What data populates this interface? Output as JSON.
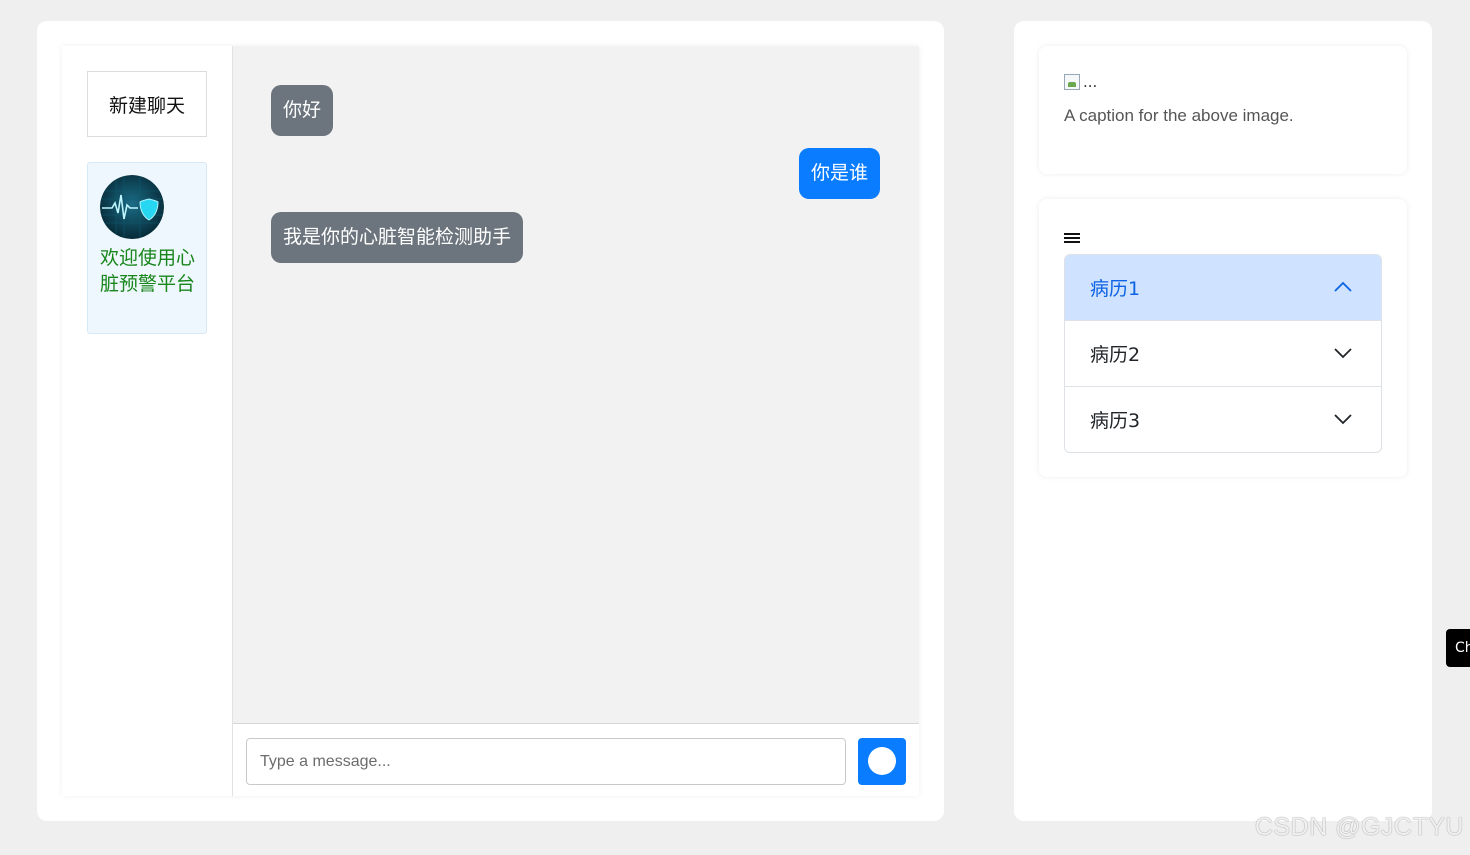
{
  "sidebar": {
    "new_chat_label": "新建聊天",
    "welcome_text": "欢迎使用心脏预警平台",
    "logo_icon": "heart-monitor-icon"
  },
  "chat": {
    "messages": [
      {
        "role": "bot",
        "text": "你好"
      },
      {
        "role": "user",
        "text": "你是谁"
      },
      {
        "role": "bot",
        "text": "我是你的心脏智能检测助手"
      }
    ],
    "input_placeholder": "Type a message...",
    "send_icon": "send-circle-icon"
  },
  "image_card": {
    "broken_image_text": "...",
    "caption": "A caption for the above image."
  },
  "accordion": {
    "menu_icon": "hamburger-menu-icon",
    "items": [
      {
        "label": "病历1",
        "expanded": true
      },
      {
        "label": "病历2",
        "expanded": false
      },
      {
        "label": "病历3",
        "expanded": false
      }
    ]
  },
  "floating_tab": {
    "label": "Ch"
  },
  "watermark": "CSDN @GJCTYU",
  "colors": {
    "accent_blue": "#0a7cff",
    "bot_bubble": "#6c757d",
    "welcome_green": "#18861b",
    "accordion_active_bg": "#cfe2ff"
  }
}
